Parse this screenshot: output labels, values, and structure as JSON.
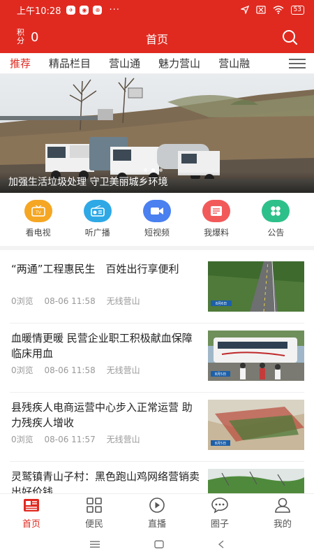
{
  "status_bar": {
    "time": "上午10:28",
    "app_icons": [
      "✈",
      "◉",
      "⊕"
    ],
    "dots": "···",
    "battery": "53"
  },
  "header": {
    "points_label": "积分",
    "points_value": "0",
    "title": "首页"
  },
  "tabs": [
    {
      "label": "推荐",
      "active": true
    },
    {
      "label": "精品栏目"
    },
    {
      "label": "营山通"
    },
    {
      "label": "魅力营山"
    },
    {
      "label": "营山融"
    }
  ],
  "banner": {
    "caption": "加强生活垃圾处理 守卫美丽城乡环境",
    "dot_count": 3,
    "active_dot": 1
  },
  "quick_nav": [
    {
      "label": "看电视",
      "icon": "tv-icon",
      "color": "#f5a623"
    },
    {
      "label": "听广播",
      "icon": "radio-icon",
      "color": "#2fa8e6"
    },
    {
      "label": "短视频",
      "icon": "video-camera-icon",
      "color": "#4a80f0"
    },
    {
      "label": "我爆料",
      "icon": "report-icon",
      "color": "#f25a5a"
    },
    {
      "label": "公告",
      "icon": "clover-icon",
      "color": "#2ec08a"
    }
  ],
  "news": [
    {
      "title": "“两通”工程惠民生　百姓出行享便利",
      "views": "0浏览",
      "date": "08-06 11:58",
      "source": "无线营山",
      "thumb_label": "8月6日"
    },
    {
      "title": "血暖情更暖 民营企业职工积极献血保障临床用血",
      "views": "0浏览",
      "date": "08-06 11:58",
      "source": "无线营山",
      "thumb_label": "8月5日"
    },
    {
      "title": "县残疾人电商运营中心步入正常运营 助力残疾人增收",
      "views": "0浏览",
      "date": "08-06 11:57",
      "source": "无线营山",
      "thumb_label": "8月5日"
    },
    {
      "title": "灵鹫镇青山子村：黑色跑山鸡网络营销卖出好价钱",
      "views": "",
      "date": "",
      "source": "",
      "thumb_label": ""
    }
  ],
  "bottom_tabs": [
    {
      "label": "首页",
      "icon": "news-icon",
      "active": true
    },
    {
      "label": "便民",
      "icon": "grid-icon"
    },
    {
      "label": "直播",
      "icon": "play-icon"
    },
    {
      "label": "圈子",
      "icon": "chat-icon"
    },
    {
      "label": "我的",
      "icon": "user-icon"
    }
  ],
  "colors": {
    "brand": "#e02a20",
    "muted_text": "#999999"
  }
}
